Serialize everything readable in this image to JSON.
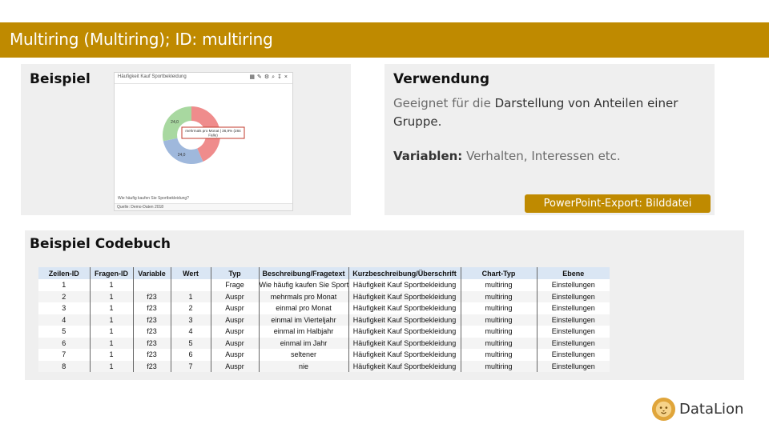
{
  "header": {
    "title": "Multiring (Multiring); ID: multiring"
  },
  "beispiel": {
    "heading": "Beispiel",
    "chart_window": {
      "title": "Häufigkeit Kauf Sportbekleidung",
      "toolbar_icons": [
        "table-icon",
        "edit-icon",
        "settings-icon",
        "zoom-icon",
        "download-icon",
        "close-icon"
      ],
      "question": "Wie häufig kaufen Sie Sportbekleidung?",
      "source": "Quelle: Demo-Daten 2018",
      "tooltip_line1": "mehrmals pro Monat | 36,9% (284",
      "tooltip_line2": "Fälle)"
    },
    "chart_data": {
      "type": "pie",
      "variant": "donut",
      "slices": [
        {
          "label": "36,9",
          "value": 36.9,
          "color": "#ef8c8c"
        },
        {
          "label": "24,0",
          "value": 24.0,
          "color": "#9fb8dc"
        },
        {
          "label": "24,0",
          "value": 24.0,
          "color": "#a8d8a0"
        }
      ],
      "highlight": "mehrmals pro Monat",
      "highlight_color": "#c0392b"
    }
  },
  "verwendung": {
    "heading": "Verwendung",
    "text_pre": "Geeignet für die ",
    "text_bold": "Darstellung von Anteilen einer Gruppe.",
    "variables_label": "Variablen:",
    "variables_value": " Verhalten, Interessen  etc.",
    "export_label": "PowerPoint-Export: Bilddatei"
  },
  "codebuch": {
    "heading": "Beispiel Codebuch",
    "columns": [
      "Zeilen-ID",
      "Fragen-ID",
      "Variable",
      "Wert",
      "Typ",
      "Beschreibung/Fragetext",
      "Kurzbeschreibung/Überschrift",
      "Chart-Typ",
      "Ebene"
    ],
    "rows": [
      [
        "1",
        "1",
        "",
        "",
        "Frage",
        "Wie häufig kaufen Sie Sportbekleidung?",
        "Häufigkeit Kauf Sportbekleidung",
        "multiring",
        "Einstellungen"
      ],
      [
        "2",
        "1",
        "f23",
        "1",
        "Auspr",
        "mehrmals pro Monat",
        "Häufigkeit Kauf Sportbekleidung",
        "multiring",
        "Einstellungen"
      ],
      [
        "3",
        "1",
        "f23",
        "2",
        "Auspr",
        "einmal pro Monat",
        "Häufigkeit Kauf Sportbekleidung",
        "multiring",
        "Einstellungen"
      ],
      [
        "4",
        "1",
        "f23",
        "3",
        "Auspr",
        "einmal im Vierteljahr",
        "Häufigkeit Kauf Sportbekleidung",
        "multiring",
        "Einstellungen"
      ],
      [
        "5",
        "1",
        "f23",
        "4",
        "Auspr",
        "einmal im Halbjahr",
        "Häufigkeit Kauf Sportbekleidung",
        "multiring",
        "Einstellungen"
      ],
      [
        "6",
        "1",
        "f23",
        "5",
        "Auspr",
        "einmal im Jahr",
        "Häufigkeit Kauf Sportbekleidung",
        "multiring",
        "Einstellungen"
      ],
      [
        "7",
        "1",
        "f23",
        "6",
        "Auspr",
        "seltener",
        "Häufigkeit Kauf Sportbekleidung",
        "multiring",
        "Einstellungen"
      ],
      [
        "8",
        "1",
        "f23",
        "7",
        "Auspr",
        "nie",
        "Häufigkeit Kauf Sportbekleidung",
        "multiring",
        "Einstellungen"
      ]
    ]
  },
  "logo": {
    "text": "DataLion",
    "icon": "lion-icon",
    "color": "#e0a53a"
  }
}
